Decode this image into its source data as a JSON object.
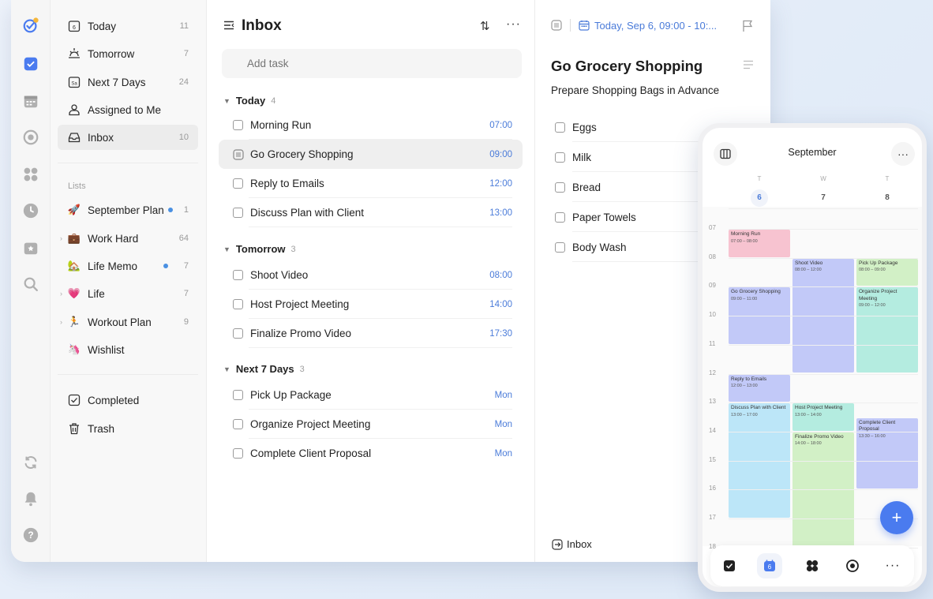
{
  "sidebar": {
    "smart": [
      {
        "label": "Today",
        "count": "11",
        "icon": "calendar-day-icon"
      },
      {
        "label": "Tomorrow",
        "count": "7",
        "icon": "sunrise-icon"
      },
      {
        "label": "Next 7 Days",
        "count": "24",
        "icon": "calendar-week-icon"
      },
      {
        "label": "Assigned to Me",
        "count": "",
        "icon": "person-icon"
      },
      {
        "label": "Inbox",
        "count": "10",
        "icon": "inbox-icon"
      }
    ],
    "lists_header": "Lists",
    "lists": [
      {
        "label": "September Plan",
        "count": "1",
        "emoji": "🚀"
      },
      {
        "label": "Work Hard",
        "count": "64",
        "emoji": "💼"
      },
      {
        "label": "Life Memo",
        "count": "7",
        "emoji": "🏡"
      },
      {
        "label": "Life",
        "count": "7",
        "emoji": "💗"
      },
      {
        "label": "Workout Plan",
        "count": "9",
        "emoji": "🏃"
      },
      {
        "label": "Wishlist",
        "count": "",
        "emoji": "🦄"
      }
    ],
    "bottom": [
      {
        "label": "Completed",
        "icon": "check-square-icon"
      },
      {
        "label": "Trash",
        "icon": "trash-icon"
      }
    ]
  },
  "list": {
    "title": "Inbox",
    "add_placeholder": "Add task",
    "groups": [
      {
        "name": "Today",
        "count": "4",
        "tasks": [
          {
            "name": "Morning Run",
            "time": "07:00"
          },
          {
            "name": "Go Grocery Shopping",
            "time": "09:00"
          },
          {
            "name": "Reply to Emails",
            "time": "12:00"
          },
          {
            "name": "Discuss Plan with Client",
            "time": "13:00"
          }
        ]
      },
      {
        "name": "Tomorrow",
        "count": "3",
        "tasks": [
          {
            "name": "Shoot Video",
            "time": "08:00"
          },
          {
            "name": "Host Project Meeting",
            "time": "14:00"
          },
          {
            "name": "Finalize Promo Video",
            "time": "17:30"
          }
        ]
      },
      {
        "name": "Next 7 Days",
        "count": "3",
        "tasks": [
          {
            "name": "Pick Up Package",
            "time": "Mon"
          },
          {
            "name": "Organize Project Meeting",
            "time": "Mon"
          },
          {
            "name": "Complete Client Proposal",
            "time": "Mon"
          }
        ]
      }
    ]
  },
  "detail": {
    "date": "Today, Sep 6, 09:00 - 10:...",
    "title": "Go Grocery Shopping",
    "subtitle": "Prepare Shopping Bags in Advance",
    "checklist": [
      "Eggs",
      "Milk",
      "Bread",
      "Paper Towels",
      "Body Wash"
    ],
    "footer": "Inbox"
  },
  "phone": {
    "month": "September",
    "weekdays": [
      "T",
      "W",
      "T"
    ],
    "days": [
      "6",
      "7",
      "8"
    ],
    "hours": [
      "07",
      "08",
      "09",
      "10",
      "11",
      "12",
      "13",
      "14",
      "15",
      "16",
      "17",
      "18"
    ],
    "events": [
      {
        "title": "Morning Run",
        "time": "07:00 – 08:00"
      },
      {
        "title": "Shoot Video",
        "time": "08:00 – 12:00"
      },
      {
        "title": "Pick Up Package",
        "time": "08:00 – 09:00"
      },
      {
        "title": "Go Grocery Shopping",
        "time": "09:00 – 11:00"
      },
      {
        "title": "Organize Project Meeting",
        "time": "09:00 – 12:00"
      },
      {
        "title": "Reply to Emails",
        "time": "12:00 – 13:00"
      },
      {
        "title": "Discuss Plan with Client",
        "time": "13:00 – 17:00"
      },
      {
        "title": "Host Project Meeting",
        "time": "13:00 – 14:00"
      },
      {
        "title": "Complete Client Proposal",
        "time": "13:30 – 16:00"
      },
      {
        "title": "Finalize Promo Video",
        "time": "14:00 – 18:00"
      }
    ],
    "tab_today": "6"
  },
  "colors": {
    "accent": "#4a7bd9",
    "ev_pink": "#f7c3d0",
    "ev_blue": "#c2c9f8",
    "ev_green": "#d2f0c6",
    "ev_teal": "#b4ece0",
    "ev_sky": "#bce6f8"
  }
}
